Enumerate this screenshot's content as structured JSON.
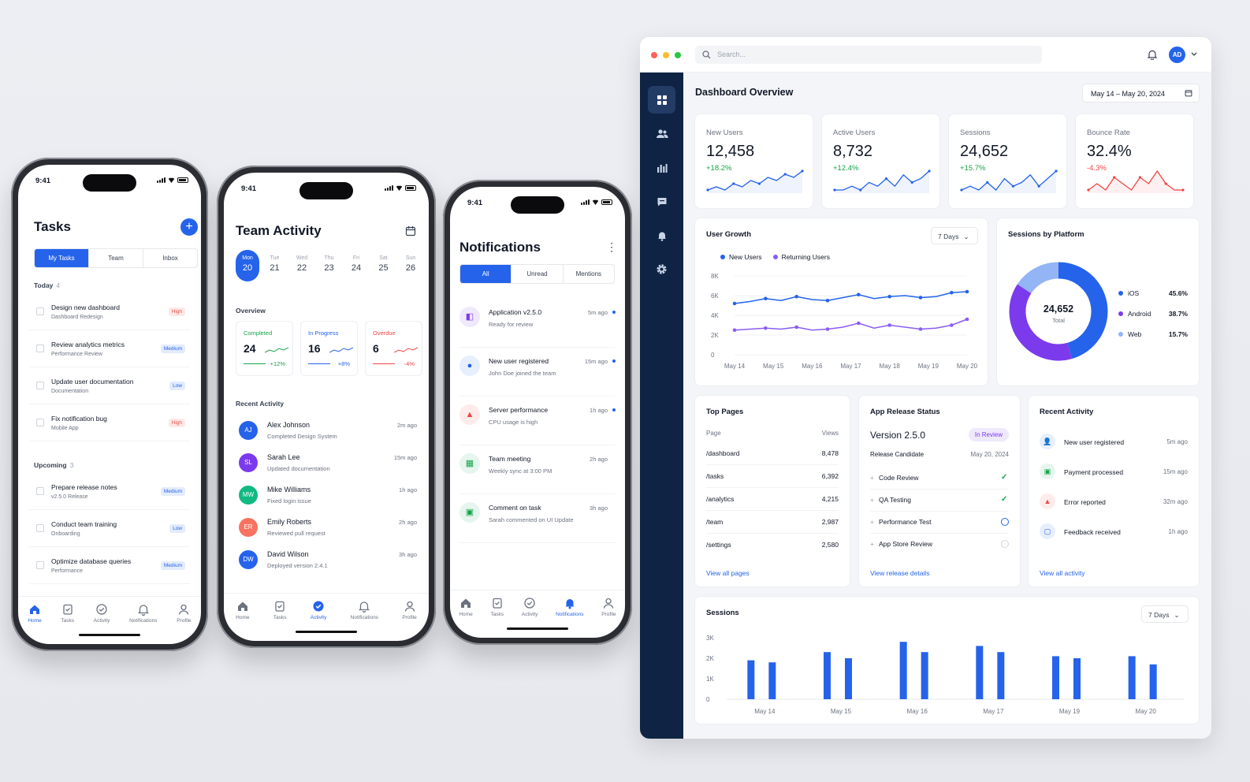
{
  "status_time": "9:41",
  "colors": {
    "accent": "#2563eb",
    "sidebar": "#0f2444",
    "positive": "#16a34a",
    "negative": "#ef4444",
    "purple": "#8b5cf6"
  },
  "tabbar": {
    "home": "Home",
    "tasks": "Tasks",
    "activity": "Activity",
    "notifications": "Notifications",
    "profile": "Profile"
  },
  "tasks": {
    "title": "Tasks",
    "add_icon": "+",
    "segments": [
      "My Tasks",
      "Team",
      "Inbox"
    ],
    "today_label": "Today",
    "today_count": "4",
    "today": [
      {
        "title": "Design new dashboard",
        "sub": "Dashboard Redesign",
        "badge": "High",
        "kind": "high"
      },
      {
        "title": "Review analytics metrics",
        "sub": "Performance Review",
        "badge": "Medium",
        "kind": "med"
      },
      {
        "title": "Update user documentation",
        "sub": "Documentation",
        "badge": "Low",
        "kind": "low"
      },
      {
        "title": "Fix notification bug",
        "sub": "Mobile App",
        "badge": "High",
        "kind": "high"
      }
    ],
    "upcoming_label": "Upcoming",
    "upcoming_count": "3",
    "upcoming": [
      {
        "title": "Prepare release notes",
        "sub": "v2.5.0 Release",
        "badge": "Medium",
        "kind": "med"
      },
      {
        "title": "Conduct team training",
        "sub": "Onboarding",
        "badge": "Low",
        "kind": "low"
      },
      {
        "title": "Optimize database queries",
        "sub": "Performance",
        "badge": "Medium",
        "kind": "med"
      }
    ]
  },
  "team": {
    "title": "Team Activity",
    "days": [
      {
        "d": "Mon",
        "n": "20"
      },
      {
        "d": "Tue",
        "n": "21"
      },
      {
        "d": "Wed",
        "n": "22"
      },
      {
        "d": "Thu",
        "n": "23"
      },
      {
        "d": "Fri",
        "n": "24"
      },
      {
        "d": "Sat",
        "n": "25"
      },
      {
        "d": "Sun",
        "n": "26"
      }
    ],
    "overview_label": "Overview",
    "stats": [
      {
        "label": "Completed",
        "value": "24",
        "delta": "+12%",
        "color": "#16a34a"
      },
      {
        "label": "In Progress",
        "value": "16",
        "delta": "+8%",
        "color": "#2563eb"
      },
      {
        "label": "Overdue",
        "value": "6",
        "delta": "-4%",
        "color": "#ef4444"
      }
    ],
    "recent_label": "Recent Activity",
    "activity": [
      {
        "initials": "AJ",
        "name": "Alex Johnson",
        "action": "Completed Design System",
        "time": "2m ago",
        "color": "#2563eb"
      },
      {
        "initials": "SL",
        "name": "Sarah Lee",
        "action": "Updated documentation",
        "time": "15m ago",
        "color": "#7c3aed"
      },
      {
        "initials": "MW",
        "name": "Mike Williams",
        "action": "Fixed login issue",
        "time": "1h ago",
        "color": "#10b981"
      },
      {
        "initials": "ER",
        "name": "Emily Roberts",
        "action": "Reviewed pull request",
        "time": "2h ago",
        "color": "#f97360"
      },
      {
        "initials": "DW",
        "name": "David Wilson",
        "action": "Deployed version 2.4.1",
        "time": "3h ago",
        "color": "#2563eb"
      }
    ]
  },
  "notifications": {
    "title": "Notifications",
    "menu_icon": "⋮",
    "segments": [
      "All",
      "Unread",
      "Mentions"
    ],
    "items": [
      {
        "title": "Application v2.5.0",
        "sub": "Ready for review",
        "time": "5m ago",
        "unread": true,
        "bg": "#efe9fc",
        "fg": "#7c3aed"
      },
      {
        "title": "New user registered",
        "sub": "John Doe joined the team",
        "time": "15m ago",
        "unread": true,
        "bg": "#e7effd",
        "fg": "#2563eb"
      },
      {
        "title": "Server performance",
        "sub": "CPU usage is high",
        "time": "1h ago",
        "unread": true,
        "bg": "#fdecea",
        "fg": "#ef4444"
      },
      {
        "title": "Team meeting",
        "sub": "Weekly sync at 3:00 PM",
        "time": "2h ago",
        "unread": false,
        "bg": "#e6f6ee",
        "fg": "#16a34a"
      },
      {
        "title": "Comment on task",
        "sub": "Sarah commented on UI Update",
        "time": "3h ago",
        "unread": false,
        "bg": "#e6f6ee",
        "fg": "#16a34a"
      }
    ]
  },
  "dash": {
    "search_placeholder": "Search...",
    "avatar": "AD",
    "title": "Dashboard Overview",
    "date_range": "May 14 – May 20, 2024",
    "kpis": [
      {
        "label": "New Users",
        "value": "12,458",
        "delta": "+18.2%",
        "up": true,
        "spark": [
          3,
          4,
          3,
          5,
          4,
          6,
          5,
          7,
          6,
          8,
          7,
          9
        ]
      },
      {
        "label": "Active Users",
        "value": "8,732",
        "delta": "+12.4%",
        "up": true,
        "spark": [
          3,
          3,
          4,
          3,
          5,
          4,
          6,
          4,
          7,
          5,
          6,
          8
        ]
      },
      {
        "label": "Sessions",
        "value": "24,652",
        "delta": "+15.7%",
        "up": true,
        "spark": [
          3,
          4,
          3,
          5,
          3,
          6,
          4,
          5,
          7,
          4,
          6,
          8
        ]
      },
      {
        "label": "Bounce Rate",
        "value": "32.4%",
        "delta": "-4.3%",
        "up": false,
        "spark": [
          4,
          5,
          4,
          6,
          5,
          4,
          6,
          5,
          7,
          5,
          4,
          4
        ]
      }
    ],
    "growth": {
      "title": "User Growth",
      "range": "7 Days",
      "legend": [
        "New Users",
        "Returning Users"
      ]
    },
    "platform": {
      "title": "Sessions by Platform",
      "total": "24,652",
      "total_label": "Total",
      "items": [
        {
          "name": "iOS",
          "pct": "45.6%",
          "v": 45.6,
          "color": "#2563eb"
        },
        {
          "name": "Android",
          "pct": "38.7%",
          "v": 38.7,
          "color": "#7c3aed"
        },
        {
          "name": "Web",
          "pct": "15.7%",
          "v": 15.7,
          "color": "#93b4f5"
        }
      ]
    },
    "top_pages": {
      "title": "Top Pages",
      "col_page": "Page",
      "col_views": "Views",
      "rows": [
        {
          "p": "/dashboard",
          "v": "8,478"
        },
        {
          "p": "/tasks",
          "v": "6,392"
        },
        {
          "p": "/analytics",
          "v": "4,215"
        },
        {
          "p": "/team",
          "v": "2,987"
        },
        {
          "p": "/settings",
          "v": "2,580"
        }
      ],
      "link": "View all pages"
    },
    "release": {
      "title": "App Release Status",
      "version": "Version 2.5.0",
      "status": "In Review",
      "stage": "Release Candidate",
      "date": "May 20, 2024",
      "steps": [
        {
          "name": "Code Review",
          "state": "done"
        },
        {
          "name": "QA Testing",
          "state": "done"
        },
        {
          "name": "Performance Test",
          "state": "progress"
        },
        {
          "name": "App Store Review",
          "state": "todo"
        }
      ],
      "link": "View release details"
    },
    "recent": {
      "title": "Recent Activity",
      "items": [
        {
          "t": "New user registered",
          "time": "5m ago",
          "bg": "#e7effd",
          "fg": "#2563eb"
        },
        {
          "t": "Payment processed",
          "time": "15m ago",
          "bg": "#e6f6ee",
          "fg": "#16a34a"
        },
        {
          "t": "Error reported",
          "time": "32m ago",
          "bg": "#fdecea",
          "fg": "#ef4444"
        },
        {
          "t": "Feedback received",
          "time": "1h ago",
          "bg": "#e7effd",
          "fg": "#2563eb"
        }
      ],
      "link": "View all activity"
    },
    "sessions": {
      "title": "Sessions",
      "range": "7 Days"
    }
  },
  "chart_data": [
    {
      "type": "line",
      "title": "User Growth",
      "x": [
        "May 14",
        "May 15",
        "May 16",
        "May 17",
        "May 18",
        "May 19",
        "May 20"
      ],
      "yticks": [
        "0",
        "2K",
        "4K",
        "6K",
        "8K"
      ],
      "ylim": [
        0,
        8000
      ],
      "series": [
        {
          "name": "New Users",
          "values": [
            5200,
            5400,
            5700,
            5500,
            5900,
            5600,
            5500,
            5800,
            6100,
            5700,
            5900,
            6000,
            5800,
            5900,
            6300,
            6400
          ],
          "color": "#2563eb"
        },
        {
          "name": "Returning Users",
          "values": [
            2500,
            2600,
            2700,
            2600,
            2800,
            2500,
            2600,
            2800,
            3200,
            2700,
            3000,
            2800,
            2600,
            2700,
            3000,
            3600
          ],
          "color": "#8b5cf6"
        }
      ]
    },
    {
      "type": "pie",
      "title": "Sessions by Platform",
      "categories": [
        "iOS",
        "Android",
        "Web"
      ],
      "values": [
        45.6,
        38.7,
        15.7
      ]
    },
    {
      "type": "bar",
      "title": "Sessions",
      "categories": [
        "May 14",
        "May 15",
        "May 16",
        "May 17",
        "May 19",
        "May 20"
      ],
      "yticks": [
        "0",
        "1K",
        "2K",
        "3K"
      ],
      "ylim": [
        0,
        3000
      ],
      "series": [
        {
          "values": [
            1900,
            2300,
            2800,
            2600,
            2100,
            2100
          ],
          "color": "#2563eb"
        },
        {
          "values": [
            1800,
            2000,
            2300,
            2300,
            2000,
            1700
          ],
          "color": "#2563eb"
        }
      ]
    }
  ]
}
